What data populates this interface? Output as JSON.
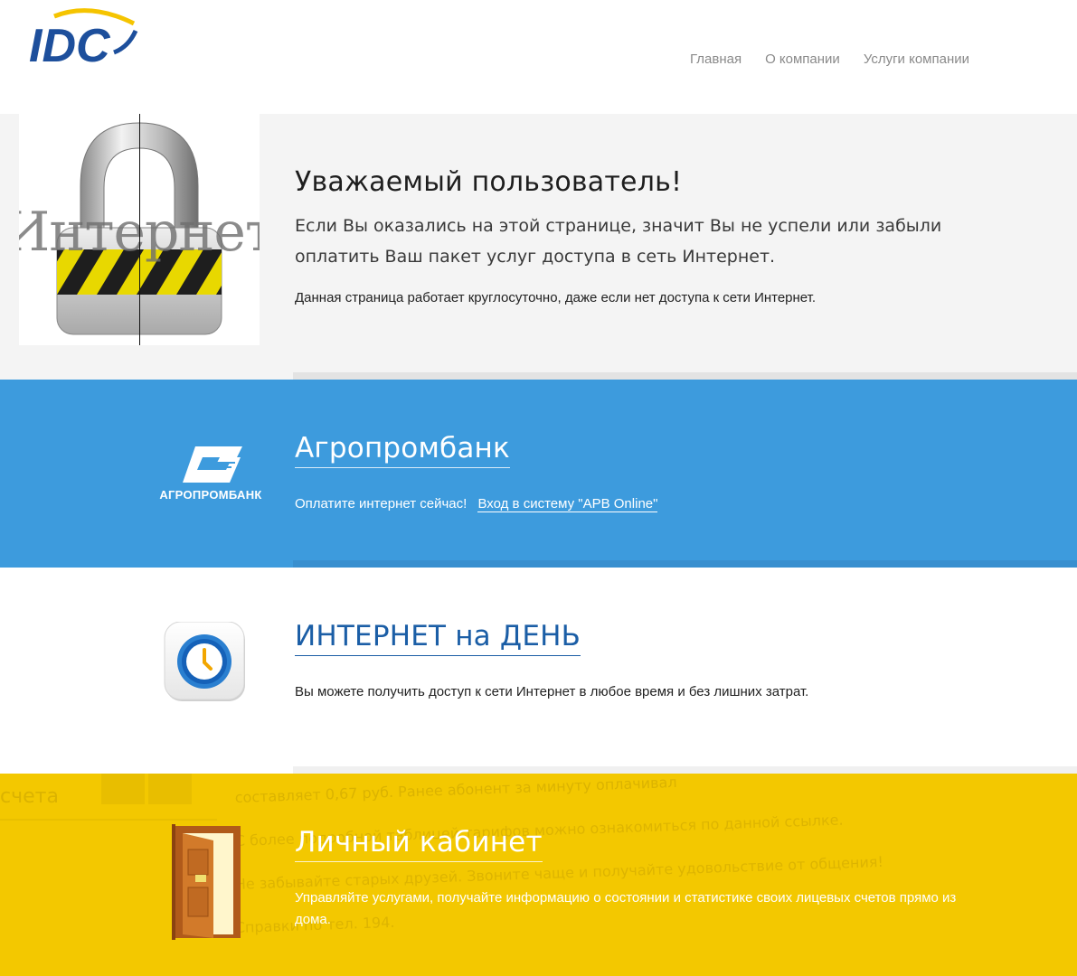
{
  "header": {
    "logo_text": "IDC",
    "nav": [
      "Главная",
      "О компании",
      "Услуги компании"
    ]
  },
  "hero": {
    "image_word": "Интернет",
    "title": "Уважаемый пользователь!",
    "text": "Если Вы оказались на этой странице, значит Вы не успели или забыли оплатить Ваш пакет услуг доступа в сеть Интернет.",
    "note": "Данная страница работает круглосуточно, даже если нет доступа к сети Интернет."
  },
  "bank": {
    "logo_text": "АГРОПРОМБАНК",
    "title": "Агропромбанк",
    "text": "Оплатите интернет сейчас!",
    "link": "Вход в систему \"APB Online\""
  },
  "day": {
    "title": "ИНТЕРНЕТ на ДЕНЬ",
    "text": "Вы можете получить доступ к сети Интернет в любое время и без лишних затрат."
  },
  "cabinet": {
    "title": "Личный кабинет",
    "text": "Управляйте услугами, получайте информацию о состоянии и статистике своих лицевых счетов прямо из дома.",
    "bg_lines": [
      "счета",
      "составляет 0,67 руб. Ранее абонент за минуту оплачивал",
      "С более подробной таблицей тарифов можно ознакомиться по данной ссылке.",
      "Не забывайте старых друзей. Звоните чаще и получайте удовольствие от общения!",
      "Справки по тел. 194."
    ]
  },
  "colors": {
    "hero_bg": "#f4f4f4",
    "bank_blue": "#3d9bdd",
    "cabinet_yellow": "#f3c800",
    "day_title_blue": "#1b5ea6",
    "logo_blue": "#1d4f9c",
    "logo_yellow": "#f5c400"
  }
}
